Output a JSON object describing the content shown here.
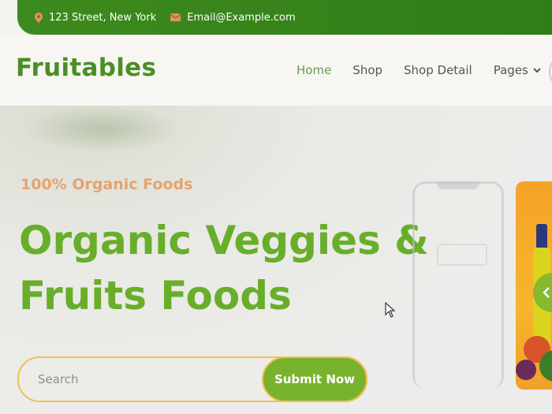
{
  "topbar": {
    "address": "123 Street, New York",
    "email": "Email@Example.com",
    "icons": {
      "address": "map-marker-icon",
      "email": "envelope-icon"
    },
    "icon_color": "#f08a5d"
  },
  "header": {
    "brand": "Fruitables",
    "nav": [
      {
        "label": "Home",
        "active": true
      },
      {
        "label": "Shop",
        "active": false
      },
      {
        "label": "Shop Detail",
        "active": false
      },
      {
        "label": "Pages",
        "active": false,
        "dropdown": true
      }
    ]
  },
  "hero": {
    "eyebrow": "100% Organic Foods",
    "title_line1": "Organic Veggies &",
    "title_line2": "Fruits Foods",
    "search": {
      "placeholder": "Search",
      "value": ""
    },
    "submit_label": "Submit Now",
    "carousel_prev_icon": "chevron-left-icon"
  },
  "colors": {
    "brand_green": "#4a8f25",
    "title_green": "#68ae2a",
    "eyebrow_orange": "#e6a36e",
    "topbar_green": "#3d8a1e",
    "button_green": "#79b32e",
    "button_border": "#f0c058"
  }
}
